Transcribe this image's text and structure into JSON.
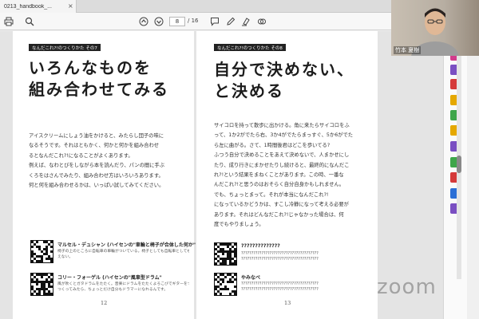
{
  "tab": {
    "title": "0213_handbook_...",
    "close": "×"
  },
  "toolbar": {
    "page_current": "8",
    "page_total": "/ 16"
  },
  "left_page": {
    "tag": "なんだこれ?!のつくりかた その7",
    "heading": [
      "いろんなものを",
      "組み合わせてみる"
    ],
    "body": [
      "アイスクリームにしょう油をかけると、みたらし団子の味に",
      "なるそうです。それはともかく、何かと何かを組み合わせ",
      "るとなんだこれ?!になることがよくあります。",
      "例えば、なわとびをしながら本を読んだり、パンの間に手ぶ",
      "くろをはさんでみたり、組み合わせ方はいろいろあります。",
      "何と何を組み合わせるかは、いっぱい試してみてください。"
    ],
    "refs": [
      {
        "title": "マルセル・デュシャン (ハイセンの\"車輪と椅子が合体した何か\"",
        "desc": [
          "椅子の上のところに自転車の車輪がついている。椅子としても自転車としても使",
          "えない。"
        ]
      },
      {
        "title": "コリー・フォーゲル (ハイセンの\"風車型ドラム\"",
        "desc": [
          "風が吹くとガタドラムをたたく。音楽にドラムをたたくよろこびでギターをつける",
          "つくってみたら、ちょっとだけ自分もドラマーになれるんです。"
        ]
      }
    ],
    "page_number": "12"
  },
  "right_page": {
    "tag": "なんだこれ?!のつくりかた その8",
    "heading": [
      "自分で決めない、",
      "と決める"
    ],
    "body": [
      "サイコロを持って散歩に出かける。角に来たらサイコロをふ",
      "って、1か2がでたら右、3か4がでたらまっすぐ、5か6がでた",
      "ら左に曲がる。さて、1時間後君はどこを歩いてる?",
      "ふつう自分で決めることをあえて決めないで、人まかせにし",
      "たり、成り行きにまかせたりし続けると、最終的になんだこ",
      "れ?!という結果をまねくことがあります。この時、一番な",
      "んだこれ?!と思うのはおそらく自分自身かもしれません。",
      "でも、ちょっとまって。それが本当になんだこれ?!",
      "になっているかどうかは、すこし冷静になって考える必要が",
      "あります。それはどんなだこれ?!じゃなかった場合は、何",
      "度でもやりましょう。"
    ],
    "refs": [
      {
        "title": "??????????????",
        "desc": [
          "??????????????????????????????????????",
          "??????????????????????????????????????"
        ]
      },
      {
        "title": "やみなべ",
        "desc": [
          "??????????????????????????????????????",
          "??????????????????????????????????????"
        ]
      }
    ],
    "page_number": "13"
  },
  "video": {
    "participant_name": "竹本 夏樹"
  },
  "watermark": "zoom",
  "colors": {
    "tool_blue": "#2b6fd6",
    "tool_pink": "#d23c8c",
    "tool_green": "#3ea64a",
    "tool_purple": "#7a4fc2",
    "tool_yellow": "#e5a800",
    "tool_red": "#d53a3a"
  },
  "icons": {
    "toolbar": [
      "print-icon",
      "search-icon",
      "page-up-icon",
      "page-down-icon",
      "comment-icon",
      "pen-icon",
      "highlight-icon",
      "share-icon"
    ],
    "tools": [
      "export-pdf-icon",
      "edit-pdf-icon",
      "create-pdf-icon",
      "comment-tool-icon",
      "combine-files-icon",
      "organize-pages-icon",
      "fill-sign-icon",
      "send-review-icon",
      "redact-icon",
      "protect-icon",
      "more-tools-icon"
    ]
  }
}
